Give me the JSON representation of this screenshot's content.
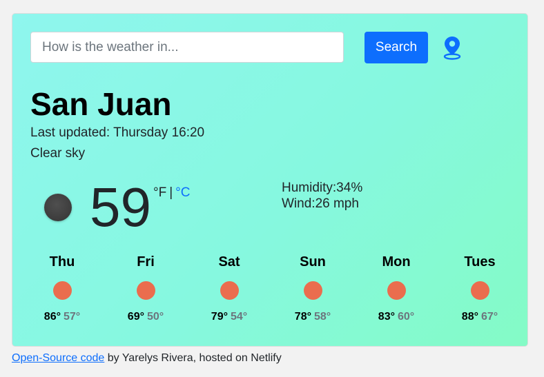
{
  "search": {
    "placeholder": "How is the weather in...",
    "value": "",
    "button_label": "Search",
    "location_icon": "map-pin-icon"
  },
  "current": {
    "city": "San Juan",
    "last_updated": "Last updated: Thursday 16:20",
    "description": "Clear sky",
    "icon": "moon-icon",
    "temperature": "59",
    "unit_f": "°F",
    "unit_separator": "|",
    "unit_c": "°C",
    "humidity": "Humidity:34%",
    "wind": "Wind:26 mph"
  },
  "forecast": [
    {
      "day": "Thu",
      "max": "86°",
      "min": "57°",
      "icon": "sun-icon"
    },
    {
      "day": "Fri",
      "max": "69°",
      "min": "50°",
      "icon": "sun-icon"
    },
    {
      "day": "Sat",
      "max": "79°",
      "min": "54°",
      "icon": "sun-icon"
    },
    {
      "day": "Sun",
      "max": "78°",
      "min": "58°",
      "icon": "sun-icon"
    },
    {
      "day": "Mon",
      "max": "83°",
      "min": "60°",
      "icon": "sun-icon"
    },
    {
      "day": "Tues",
      "max": "88°",
      "min": "67°",
      "icon": "sun-icon"
    }
  ],
  "footer": {
    "link_text": "Open-Source code",
    "rest": " by Yarelys Rivera, hosted on Netlify"
  },
  "colors": {
    "accent": "#0d6efd",
    "sun": "#ea6d4e",
    "card_gradient_start": "#8ff6ee",
    "card_gradient_end": "#84fbc6"
  }
}
